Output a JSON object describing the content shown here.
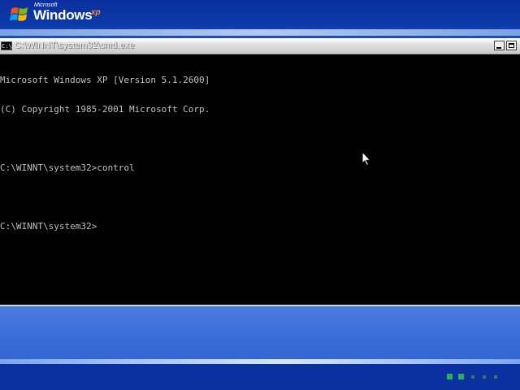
{
  "branding": {
    "microsoft": "Microsoft",
    "windows": "Windows",
    "xp": "xp"
  },
  "window": {
    "icon_label": "C:\\",
    "title": "C:\\WINNT\\system32\\cmd.exe"
  },
  "console": {
    "lines": [
      "Microsoft Windows XP [Version 5.1.2600]",
      "(C) Copyright 1985-2001 Microsoft Corp.",
      "",
      "C:\\WINNT\\system32>control",
      "",
      "C:\\WINNT\\system32>"
    ]
  },
  "colors": {
    "desktop_blue": "#1f4fb4",
    "console_bg": "#000000",
    "console_text": "#c0c0c0",
    "progress_green": "#24b25c"
  },
  "icons": {
    "minimize": "minimize-icon",
    "maximize": "maximize-icon",
    "cursor": "arrow-pointer-icon",
    "logo": "windows-flag-icon"
  }
}
